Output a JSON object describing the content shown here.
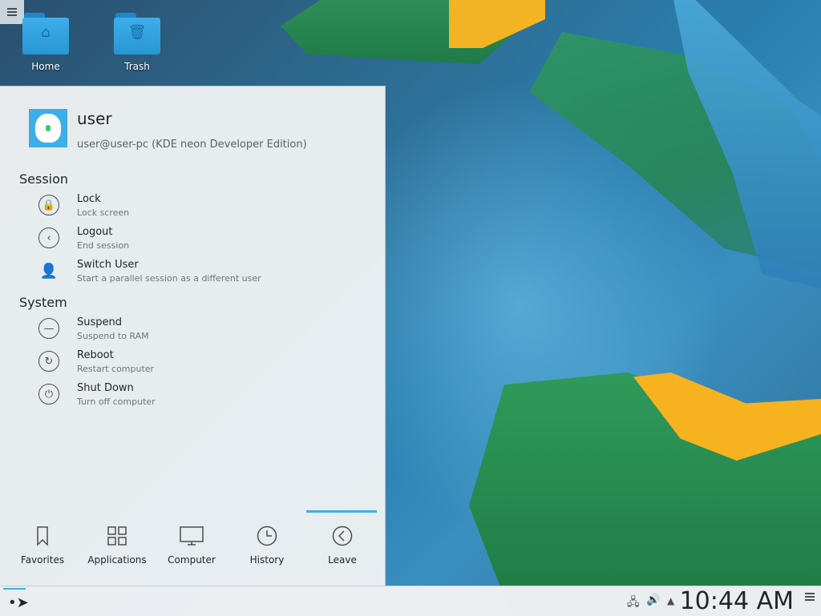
{
  "desktop": {
    "icons": [
      {
        "label": "Home",
        "icon": "home-folder-icon"
      },
      {
        "label": "Trash",
        "icon": "trash-folder-icon"
      }
    ]
  },
  "launcher": {
    "user": {
      "name": "user",
      "host": "user@user-pc (KDE neon Developer Edition)"
    },
    "sections": {
      "session": "Session",
      "system": "System"
    },
    "entries": {
      "lock": {
        "title": "Lock",
        "sub": "Lock screen",
        "icon": "lock-icon"
      },
      "logout": {
        "title": "Logout",
        "sub": "End session",
        "icon": "logout-icon"
      },
      "switch_user": {
        "title": "Switch User",
        "sub": "Start a parallel session as a different user",
        "icon": "switch-user-icon"
      },
      "suspend": {
        "title": "Suspend",
        "sub": "Suspend to RAM",
        "icon": "suspend-icon"
      },
      "reboot": {
        "title": "Reboot",
        "sub": "Restart computer",
        "icon": "reboot-icon"
      },
      "shutdown": {
        "title": "Shut Down",
        "sub": "Turn off computer",
        "icon": "shutdown-icon"
      }
    },
    "tabs": [
      {
        "label": "Favorites",
        "icon": "bookmark-icon"
      },
      {
        "label": "Applications",
        "icon": "grid-icon"
      },
      {
        "label": "Computer",
        "icon": "monitor-icon"
      },
      {
        "label": "History",
        "icon": "clock-icon"
      },
      {
        "label": "Leave",
        "icon": "leave-icon"
      }
    ],
    "active_tab": "Leave"
  },
  "taskbar": {
    "clock": "10:44 AM",
    "accent": "#3daee9"
  }
}
